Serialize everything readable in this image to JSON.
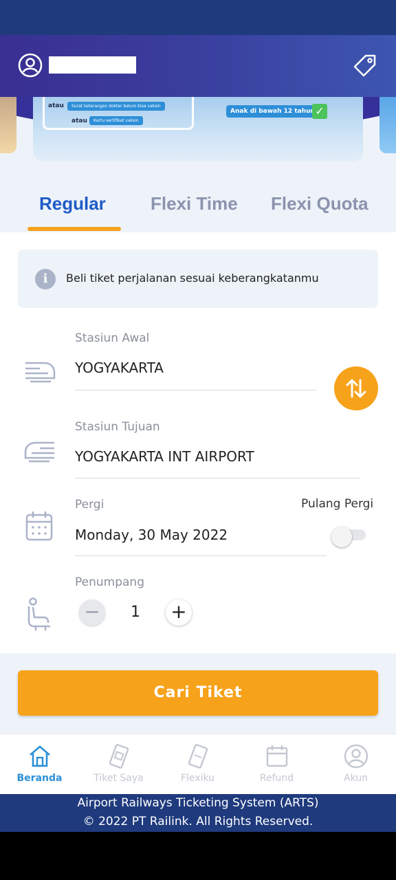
{
  "banner": {
    "line1_prefix": "atau",
    "line1_pill": "Surat keterangan dokter belum bisa vaksin",
    "line2_prefix": "atau",
    "line2_pill": "Kartu sertifikat vaksin",
    "child_pill": "Anak di bawah 12 tahun"
  },
  "tabs": [
    {
      "label": "Regular",
      "active": true
    },
    {
      "label": "Flexi Time",
      "active": false
    },
    {
      "label": "Flexi Quota",
      "active": false
    }
  ],
  "info": {
    "text": "Beli tiket perjalanan sesuai keberangkatanmu",
    "icon": "info-icon"
  },
  "form": {
    "origin": {
      "label": "Stasiun Awal",
      "value": "YOGYAKARTA"
    },
    "destination": {
      "label": "Stasiun Tujuan",
      "value": "YOGYAKARTA INT AIRPORT"
    },
    "departure": {
      "label": "Pergi",
      "value": "Monday, 30 May 2022"
    },
    "round_trip": {
      "label": "Pulang Pergi",
      "enabled": false
    },
    "passengers": {
      "label": "Penumpang",
      "count": "1"
    }
  },
  "search_button": "Cari Tiket",
  "nav": [
    {
      "label": "Beranda",
      "icon": "home-icon",
      "active": true
    },
    {
      "label": "Tiket Saya",
      "icon": "ticket-icon",
      "active": false
    },
    {
      "label": "Flexiku",
      "icon": "flexi-ticket-icon",
      "active": false
    },
    {
      "label": "Refund",
      "icon": "calendar-icon",
      "active": false
    },
    {
      "label": "Akun",
      "icon": "account-icon",
      "active": false
    }
  ],
  "footer": {
    "line1": "Airport Railways Ticketing System (ARTS)",
    "line2": "© 2022 PT Railink. All Rights Reserved."
  },
  "colors": {
    "primary": "#1e5bc6",
    "accent": "#f7a21b",
    "header": "#3a2f93",
    "footer": "#1f3a7d",
    "nav_active": "#2b8fd6"
  }
}
